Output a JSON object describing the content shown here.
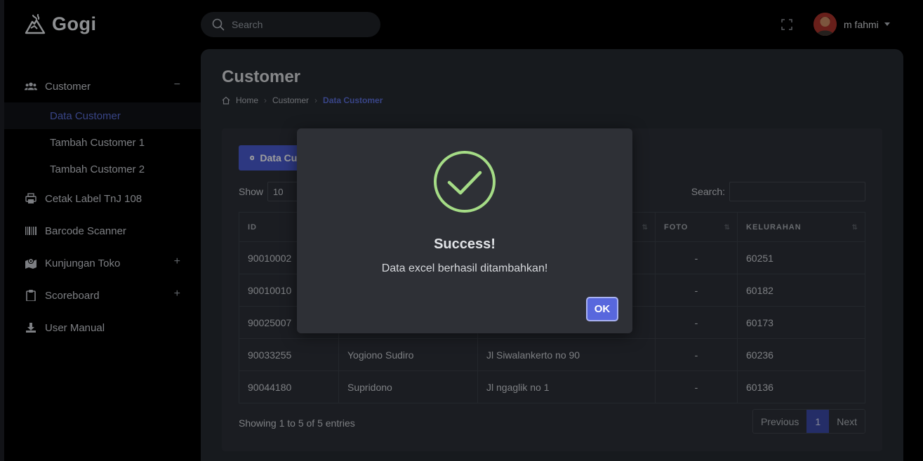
{
  "brand": {
    "name": "Gogi"
  },
  "topbar": {
    "search_placeholder": "Search",
    "user_name": "m fahmi"
  },
  "sidebar": {
    "items": [
      {
        "label": "Customer",
        "icon": "users-icon",
        "toggle": "−"
      },
      {
        "label": "Cetak Label TnJ 108",
        "icon": "printer-icon"
      },
      {
        "label": "Barcode Scanner",
        "icon": "barcode-icon"
      },
      {
        "label": "Kunjungan Toko",
        "icon": "map-icon",
        "toggle": "+"
      },
      {
        "label": "Scoreboard",
        "icon": "clipboard-icon",
        "toggle": "+"
      },
      {
        "label": "User Manual",
        "icon": "download-icon"
      }
    ],
    "customer_sub": [
      "Data Customer",
      "Tambah Customer 1",
      "Tambah Customer 2"
    ]
  },
  "page": {
    "title": "Customer",
    "breadcrumb": [
      "Home",
      "Customer",
      "Data Customer"
    ]
  },
  "card": {
    "add_button_label": "Data Customer",
    "show_label": "Show",
    "show_value": "10",
    "search_label": "Search:"
  },
  "table": {
    "headers": [
      "ID",
      "",
      "",
      "FOTO",
      "KELURAHAN"
    ],
    "rows": [
      [
        "90010002",
        "",
        "",
        "-",
        "60251"
      ],
      [
        "90010010",
        "",
        "",
        "-",
        "60182"
      ],
      [
        "90025007",
        "",
        "",
        "-",
        "60173"
      ],
      [
        "90033255",
        "Yogiono Sudiro",
        "Jl Siwalankerto no 90",
        "-",
        "60236"
      ],
      [
        "90044180",
        "Supridono",
        "Jl ngaglik no 1",
        "-",
        "60136"
      ]
    ]
  },
  "footer": {
    "info": "Showing 1 to 5 of 5 entries",
    "prev": "Previous",
    "page": "1",
    "next": "Next"
  },
  "modal": {
    "title": "Success!",
    "text": "Data excel berhasil ditambahkan!",
    "ok": "OK"
  },
  "colors": {
    "accent": "#4a5bd0",
    "active_link": "#5b6fd8",
    "success": "#a5dc86"
  }
}
